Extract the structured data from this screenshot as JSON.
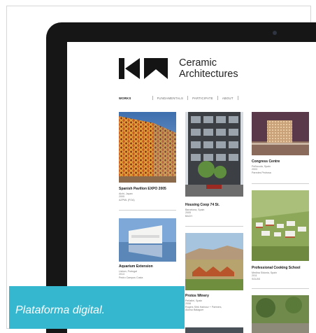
{
  "brand": {
    "line1": "Ceramic",
    "line2": "Architectures"
  },
  "nav": [
    {
      "label": "WORKS",
      "active": true
    },
    {
      "label": "FUNDAMENTALS",
      "active": false
    },
    {
      "label": "PARTICIPATE",
      "active": false
    },
    {
      "label": "ABOUT",
      "active": false
    }
  ],
  "works": [
    {
      "title": "Spanish Pavilion EXPO 2005",
      "meta": [
        "Aichi, Japan",
        "2005",
        "AZPML (FOA)"
      ]
    },
    {
      "title": "Aquarium Extension",
      "meta": [
        "Lisbon, Portugal",
        "2013",
        "Pedro Campos Costa"
      ]
    },
    {
      "title": "Housing Coop 74 St.",
      "meta": [
        "Barcelona, Spain",
        "2005",
        "BACH"
      ]
    },
    {
      "title": "Protos Winery",
      "meta": [
        "Peñafiel, Spain",
        "2008",
        "Rogers Stirk Harbour + Partners,",
        "Alonso Balaguer"
      ]
    },
    {
      "title": "Congress Centre",
      "meta": [
        "Peñíscola, Spain",
        "2003",
        "Paredes Pedrosa"
      ]
    },
    {
      "title": "Professional Cooking School",
      "meta": [
        "Medina Sidonia, Spain",
        "2011",
        "SOLBS"
      ]
    }
  ],
  "caption": "Plataforma digital.",
  "colors": {
    "accent": "#35b7cf",
    "bezel": "#161616"
  }
}
